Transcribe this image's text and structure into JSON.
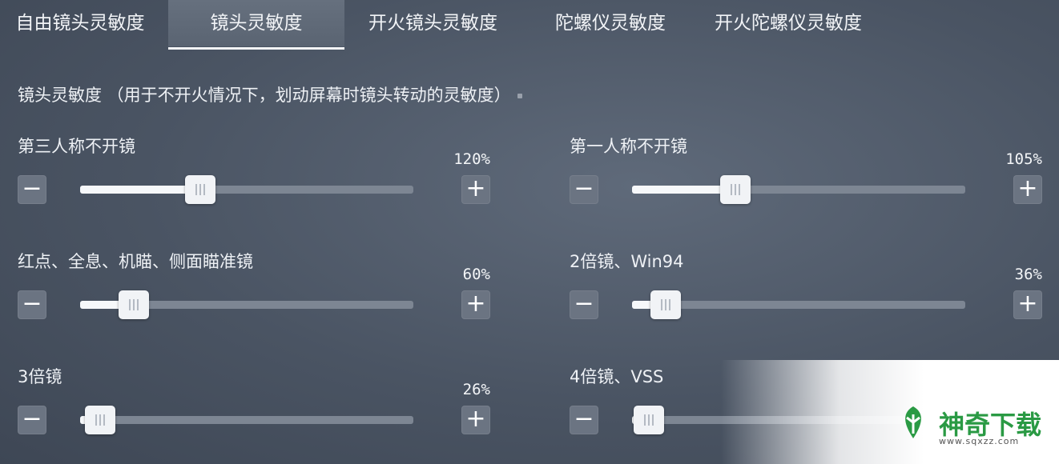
{
  "tabs": [
    {
      "label": "自由镜头灵敏度",
      "active": false
    },
    {
      "label": "镜头灵敏度",
      "active": true
    },
    {
      "label": "开火镜头灵敏度",
      "active": false
    },
    {
      "label": "陀螺仪灵敏度",
      "active": false
    },
    {
      "label": "开火陀螺仪灵敏度",
      "active": false
    }
  ],
  "section": {
    "title": "镜头灵敏度 （用于不开火情况下，划动屏幕时镜头转动的灵敏度）"
  },
  "buttons": {
    "minus": "−",
    "plus": "+"
  },
  "settings": [
    {
      "label": "第三人称不开镜",
      "value": "120%",
      "level": 0.36
    },
    {
      "label": "第一人称不开镜",
      "value": "105%",
      "level": 0.31
    },
    {
      "label": "红点、全息、机瞄、侧面瞄准镜",
      "value": "60%",
      "level": 0.16
    },
    {
      "label": "2倍镜、Win94",
      "value": "36%",
      "level": 0.1
    },
    {
      "label": "3倍镜",
      "value": "26%",
      "level": 0.06
    },
    {
      "label": "4倍镜、VSS",
      "value": "",
      "level": 0.05
    }
  ],
  "watermark": {
    "brand": "神奇下载",
    "url": "www.sqxzz.com",
    "logo_color": "#2a9a44"
  }
}
